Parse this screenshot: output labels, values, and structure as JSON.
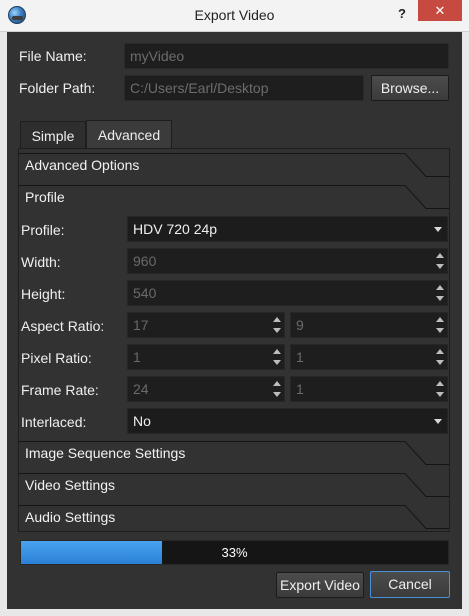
{
  "window": {
    "title": "Export Video",
    "help_glyph": "?",
    "close_glyph": "✕"
  },
  "file": {
    "name_label": "File Name:",
    "name_value": "myVideo",
    "folder_label": "Folder Path:",
    "folder_value": "C:/Users/Earl/Desktop",
    "browse_label": "Browse..."
  },
  "tabs": [
    {
      "label": "Simple",
      "active": false
    },
    {
      "label": "Advanced",
      "active": true
    }
  ],
  "sections": {
    "advanced_options": "Advanced Options",
    "profile": "Profile",
    "image_sequence": "Image Sequence Settings",
    "video": "Video Settings",
    "audio": "Audio Settings"
  },
  "profile": {
    "profile_label": "Profile:",
    "profile_value": "HDV 720 24p",
    "width_label": "Width:",
    "width_value": "960",
    "height_label": "Height:",
    "height_value": "540",
    "aspect_label": "Aspect Ratio:",
    "aspect_num": "17",
    "aspect_den": "9",
    "pixel_label": "Pixel Ratio:",
    "pixel_num": "1",
    "pixel_den": "1",
    "frame_label": "Frame Rate:",
    "frame_num": "24",
    "frame_den": "1",
    "interlaced_label": "Interlaced:",
    "interlaced_value": "No"
  },
  "progress": {
    "value": 0.33,
    "text": "33%"
  },
  "actions": {
    "export_label": "Export Video",
    "cancel_label": "Cancel"
  },
  "colors": {
    "accent": "#2b80d6",
    "background": "#323232",
    "close": "#c74a41"
  }
}
